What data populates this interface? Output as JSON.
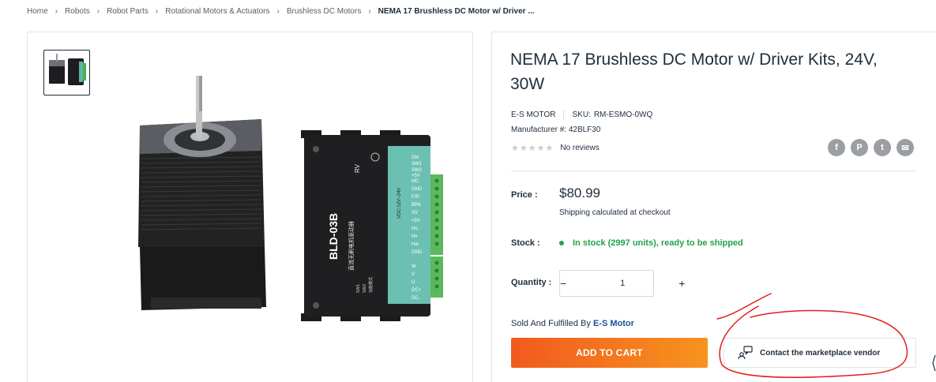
{
  "breadcrumb": {
    "items": [
      "Home",
      "Robots",
      "Robot Parts",
      "Rotational Motors & Actuators",
      "Brushless DC Motors"
    ],
    "current": "NEMA 17 Brushless DC Motor w/ Driver ...",
    "separator": "›"
  },
  "gallery": {
    "image_labels": {
      "driver_model": "BLD-03B",
      "driver_chinese": "直流无刷电机驱动器",
      "rv": "RV",
      "voltage": "VDC:12V~24V",
      "switch_marks": [
        "ON",
        "SW1",
        "SW2"
      ],
      "pins_top": [
        "+5V",
        "MC",
        "GND",
        "F/R",
        "BRK",
        "SV",
        "+5V",
        "Hu",
        "Hv",
        "Hw",
        "GND"
      ],
      "pins_bottom": [
        "W",
        "V",
        "U",
        "DC+",
        "DC-"
      ],
      "table_header": [
        "SW1",
        "SW2",
        "功能模式"
      ],
      "table_rows": [
        [
          "0",
          "1",
          "内部调速"
        ],
        [
          "1",
          "0",
          "外部0-5V"
        ],
        [
          "0",
          "0",
          "外部PWM"
        ],
        [
          "1",
          "1",
          "停止"
        ]
      ]
    }
  },
  "product": {
    "title": "NEMA 17 Brushless DC Motor w/ Driver Kits, 24V, 30W",
    "brand": "E-S MOTOR",
    "sku_label": "SKU:",
    "sku": "RM-ESMO-0WQ",
    "manufacturer_label": "Manufacturer #:",
    "manufacturer_number": "42BLF30",
    "stars": "★★★★★",
    "reviews": "No reviews",
    "price_label": "Price :",
    "price": "$80.99",
    "shipping_note": "Shipping calculated at checkout",
    "stock_label": "Stock :",
    "stock_text": "In stock (2997 units), ready to be shipped",
    "quantity_label": "Quantity :",
    "quantity_value": "1",
    "quantity_minus": "−",
    "quantity_plus": "+",
    "sold_by_prefix": "Sold And Fulfilled By",
    "vendor": "E-S Motor",
    "add_to_cart": "ADD TO CART",
    "contact_vendor": "Contact the marketplace vendor"
  },
  "share": {
    "icons": [
      "facebook-icon",
      "pinterest-icon",
      "twitter-icon",
      "email-icon"
    ],
    "glyphs": [
      "f",
      "P",
      "t",
      "✉"
    ]
  },
  "colors": {
    "accent_orange_start": "#f15a1e",
    "accent_orange_end": "#f7931e",
    "in_stock_green": "#22a14a",
    "vendor_blue": "#1e4e9c",
    "annotation_red": "#e0201b"
  }
}
